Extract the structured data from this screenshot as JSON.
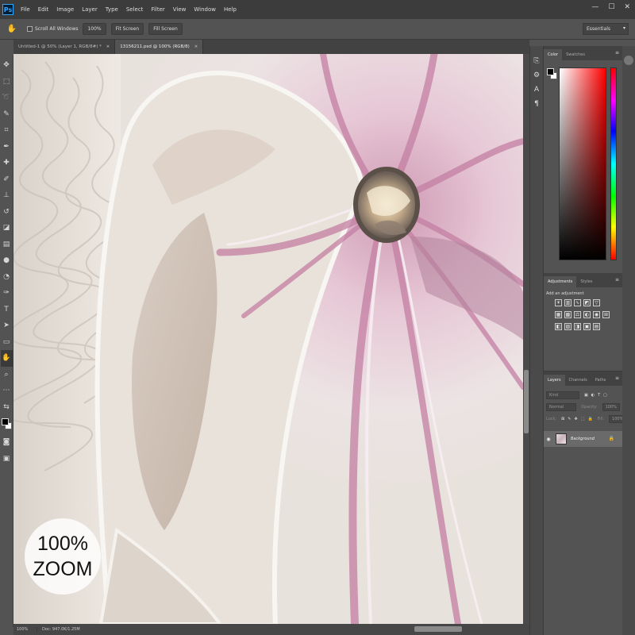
{
  "app": {
    "logo": "Ps",
    "menu": [
      "File",
      "Edit",
      "Image",
      "Layer",
      "Type",
      "Select",
      "Filter",
      "View",
      "Window",
      "Help"
    ],
    "window_controls": [
      "—",
      "☐",
      "✕"
    ]
  },
  "options_bar": {
    "scroll_all_label": "Scroll All Windows",
    "zoom_100": "100%",
    "fit_screen": "Fit Screen",
    "fill_screen": "Fill Screen",
    "workspace": "Essentials"
  },
  "tabs": [
    {
      "label": "Untitled-1 @ 50% (Layer 1, RGB/8#) *",
      "active": false
    },
    {
      "label": "13156211.psd @ 100% (RGB/8)",
      "active": true
    }
  ],
  "canvas": {
    "zoom_badge_line1": "100%",
    "zoom_badge_line2": "ZOOM"
  },
  "status": {
    "zoom": "100%",
    "doc": "Doc: 947.0K/1.25M"
  },
  "color_panel": {
    "tabs": [
      "Color",
      "Swatches"
    ]
  },
  "adjustments_panel": {
    "tabs": [
      "Adjustments",
      "Styles"
    ],
    "add_label": "Add an adjustment"
  },
  "layers_panel": {
    "tabs": [
      "Layers",
      "Channels",
      "Paths"
    ],
    "search_placeholder": "Kind",
    "blend_mode": "Normal",
    "opacity_label": "Opacity:",
    "opacity_value": "100%",
    "lock_label": "Lock:",
    "fill_label": "Fill:",
    "fill_value": "100%",
    "layer_name": "Background"
  },
  "colors": {
    "ui_dark": "#3c3c3c",
    "ui_mid": "#535353",
    "ps_blue": "#31a8ff"
  }
}
